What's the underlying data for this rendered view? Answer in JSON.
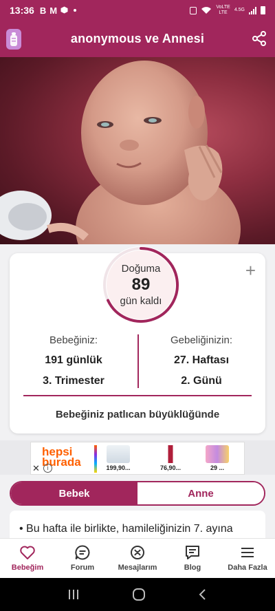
{
  "status_bar": {
    "time": "13:36",
    "left_icons": [
      "B",
      "M"
    ],
    "network": "LTE",
    "network_speed": "4.5G",
    "volte": "VoLTE"
  },
  "header": {
    "title": "anonymous ve Annesi",
    "left_icon": "baby-bottle-icon",
    "right_icon": "share-icon"
  },
  "countdown": {
    "line1": "Doğuma",
    "days": "89",
    "line3": "gün kaldı",
    "progress_fraction": 0.68
  },
  "stats": {
    "left_header": "Bebeğiniz:",
    "left_value1": "191 günlük",
    "left_value2": "3. Trimester",
    "right_header": "Gebeliğinizin:",
    "right_value1": "27. Haftası",
    "right_value2": "2. Günü"
  },
  "size_text": "Bebeğiniz patlıcan büyüklüğünde",
  "ad": {
    "brand_line1": "hepsi",
    "brand_line2": "burada",
    "prices": [
      "199,90...",
      "76,90...",
      "29 ..."
    ]
  },
  "tabs": {
    "active": "Bebek",
    "inactive": "Anne"
  },
  "content": {
    "first_line": "• Bu hafta ile birlikte, hamileliğinizin 7. ayına"
  },
  "nav": {
    "items": [
      {
        "label": "Bebeğim",
        "icon": "heart-icon"
      },
      {
        "label": "Forum",
        "icon": "chat-bubble-icon"
      },
      {
        "label": "Mesajlarım",
        "icon": "messages-icon"
      },
      {
        "label": "Blog",
        "icon": "blog-icon"
      },
      {
        "label": "Daha Fazla",
        "icon": "menu-icon"
      }
    ]
  },
  "colors": {
    "primary": "#a1265c",
    "ad_brand": "#ff6000"
  }
}
